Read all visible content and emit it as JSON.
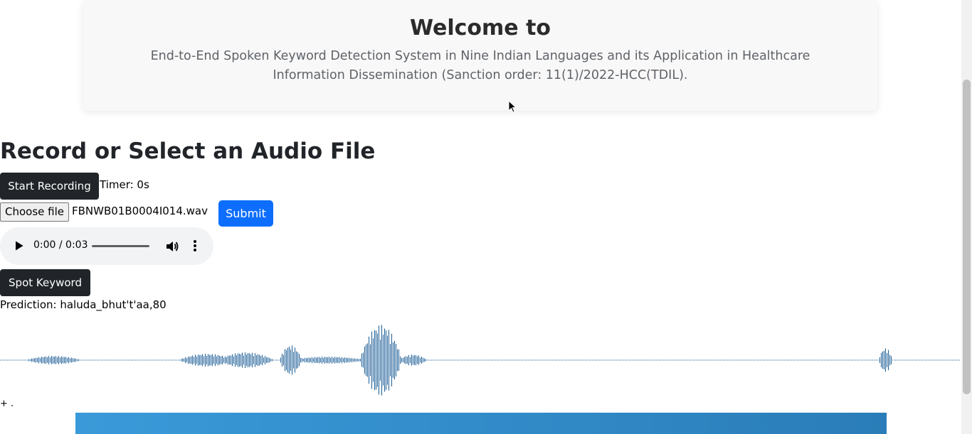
{
  "header": {
    "title": "Welcome to",
    "subtitle": "End-to-End Spoken Keyword Detection System in Nine Indian Languages and its Application in Healthcare Information Dissemination (Sanction order: 11(1)/2022-HCC(TDIL)."
  },
  "main": {
    "section_title": "Record or Select an Audio File",
    "start_recording_label": "Start Recording",
    "timer_text": "Timer: 0s",
    "choose_file_label": "Choose file",
    "file_name": "FBNWB01B0004I014.wav",
    "submit_label": "Submit",
    "audio": {
      "time_display": "0:00 / 0:03",
      "progress": 0
    },
    "spot_keyword_label": "Spot Keyword",
    "prediction_text": "Prediction: haluda_bhut't'aa,80",
    "footnote": "+ ."
  },
  "colors": {
    "waveform": "#1a5c96",
    "submit": "#0d6efd",
    "dark_button": "#212529",
    "banner_start": "#3a9ad9",
    "banner_end": "#2a7db8"
  },
  "icons": [
    "play-icon",
    "volume-icon",
    "more-options-icon",
    "mouse-cursor-icon"
  ]
}
